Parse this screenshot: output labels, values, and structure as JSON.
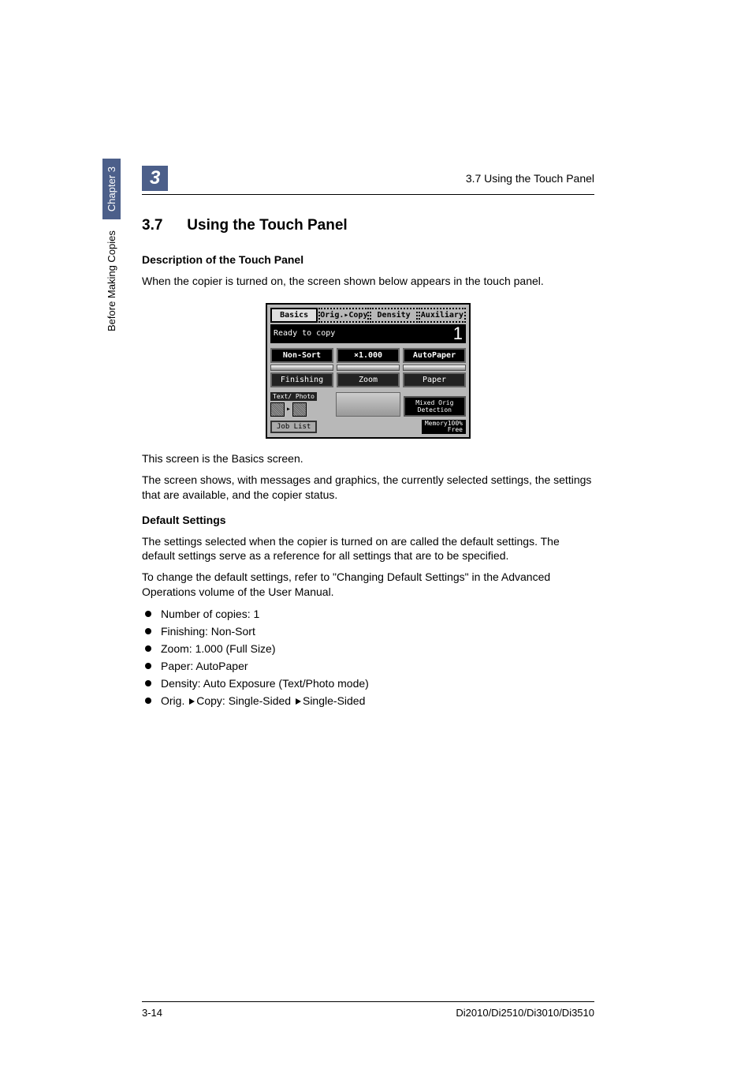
{
  "header": {
    "chapter_number": "3",
    "running_head": "3.7 Using the Touch Panel"
  },
  "side": {
    "text": "Before Making Copies",
    "chapter": "Chapter 3"
  },
  "section": {
    "number": "3.7",
    "title": "Using the Touch Panel"
  },
  "sub1": {
    "heading": "Description of the Touch Panel",
    "intro": "When the copier is turned on, the screen shown below appears in the touch panel."
  },
  "touch_panel": {
    "tabs": [
      "Basics",
      "Orig.▸Copy",
      "Density",
      "Auxiliary"
    ],
    "status_text": "Ready to copy",
    "copy_count": "1",
    "row_btns": [
      "Non-Sort",
      "×1.000",
      "AutoPaper"
    ],
    "row_labels": [
      "Finishing",
      "Zoom",
      "Paper"
    ],
    "text_photo": "Text/\nPhoto",
    "mixed": "Mixed Orig\nDetection",
    "job_list": "Job List",
    "memory_label": "Memory",
    "memory_value": "100%",
    "memory_free": "Free"
  },
  "after_panel": {
    "line1": "This screen is the Basics screen.",
    "line2": "The screen shows, with messages and graphics, the currently selected settings, the settings that are available, and the copier status."
  },
  "sub2": {
    "heading": "Default Settings",
    "p1": "The settings selected when the copier is turned on are called the default settings. The default settings serve as a reference for all settings that are to be specified.",
    "p2": "To change the default settings, refer to \"Changing Default Settings\" in the Advanced Operations volume of the User Manual.",
    "bullets": {
      "b1": "Number of copies: 1",
      "b2": "Finishing: Non-Sort",
      "b3": "Zoom: 1.000 (Full Size)",
      "b4": "Paper: AutoPaper",
      "b5": "Density: Auto Exposure (Text/Photo mode)",
      "b6_pre": "Orig. ",
      "b6_mid": "Copy: Single-Sided ",
      "b6_post": "Single-Sided"
    }
  },
  "footer": {
    "page": "3-14",
    "models": "Di2010/Di2510/Di3010/Di3510"
  }
}
